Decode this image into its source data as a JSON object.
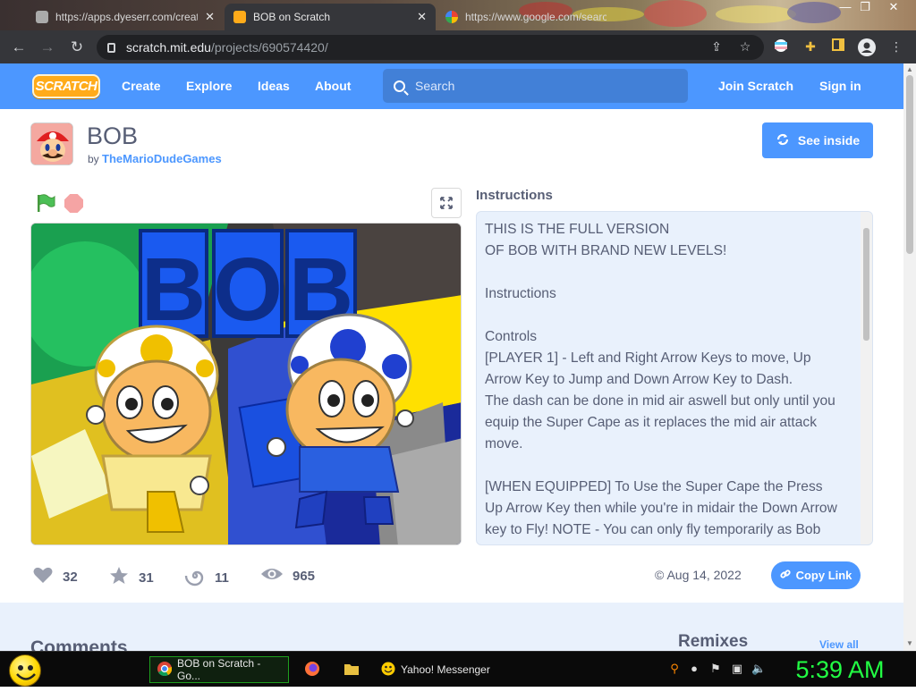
{
  "browser": {
    "tabs": [
      {
        "title": "https://apps.dyeserr.com/create/...",
        "active": false
      },
      {
        "title": "BOB on Scratch",
        "active": true
      },
      {
        "title": "https://www.google.com/search...",
        "active": false
      }
    ],
    "url_host": "scratch.mit.edu",
    "url_path": "/projects/690574420/"
  },
  "scratch_nav": {
    "logo": "SCRATCH",
    "links": [
      "Create",
      "Explore",
      "Ideas",
      "About"
    ],
    "search_placeholder": "Search",
    "join": "Join Scratch",
    "signin": "Sign in"
  },
  "project": {
    "title": "BOB",
    "by": "by",
    "author": "TheMarioDudeGames",
    "see_inside": "See inside",
    "stage_title_letters": [
      "B",
      "O",
      "B"
    ]
  },
  "instructions": {
    "heading": "Instructions",
    "lines": [
      "THIS IS THE FULL VERSION",
      "OF BOB WITH BRAND NEW LEVELS!",
      "",
      "Instructions",
      "",
      "Controls",
      "[PLAYER 1] - Left and Right Arrow Keys to move, Up",
      "Arrow Key to Jump and Down Arrow Key to Dash.",
      "The dash can be done in mid air aswell but only until you",
      "equip the Super Cape as it replaces the mid air attack",
      "move.",
      "",
      "[WHEN EQUIPPED] To Use the Super Cape the Press",
      "Up Arrow Key then while you're in midair the Down Arrow",
      "key to Fly! NOTE - You can only fly temporarily as Bob"
    ]
  },
  "stats": {
    "loves": "32",
    "favorites": "31",
    "remixes": "11",
    "views": "965",
    "date": "Aug 14, 2022",
    "copy_link": "Copy Link"
  },
  "lower": {
    "comments": "Comments",
    "remixes": "Remixes",
    "view_all": "View all"
  },
  "taskbar": {
    "items": [
      {
        "label": "BOB on Scratch - Go...",
        "active": true
      },
      {
        "label": "",
        "active": false
      },
      {
        "label": "",
        "active": false
      },
      {
        "label": "Yahoo! Messenger",
        "active": false
      }
    ],
    "clock": "5:39 AM"
  },
  "colors": {
    "scratch_blue": "#4c97ff",
    "text": "#575e75",
    "clock_green": "#22ff44"
  }
}
